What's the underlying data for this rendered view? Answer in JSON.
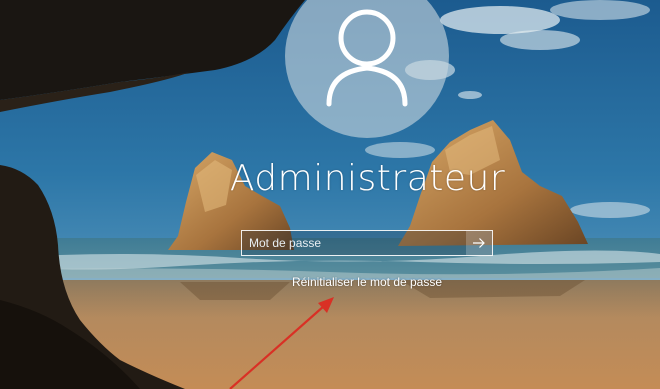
{
  "lockscreen": {
    "username": "Administrateur",
    "avatar_icon": "user-icon",
    "password": {
      "placeholder": "Mot de passe",
      "value": ""
    },
    "submit_icon": "arrow-right-icon",
    "reset_link": "Réinitialiser le mot de passe"
  },
  "annotation": {
    "icon": "red-arrow-annotation",
    "color": "#d93025"
  }
}
